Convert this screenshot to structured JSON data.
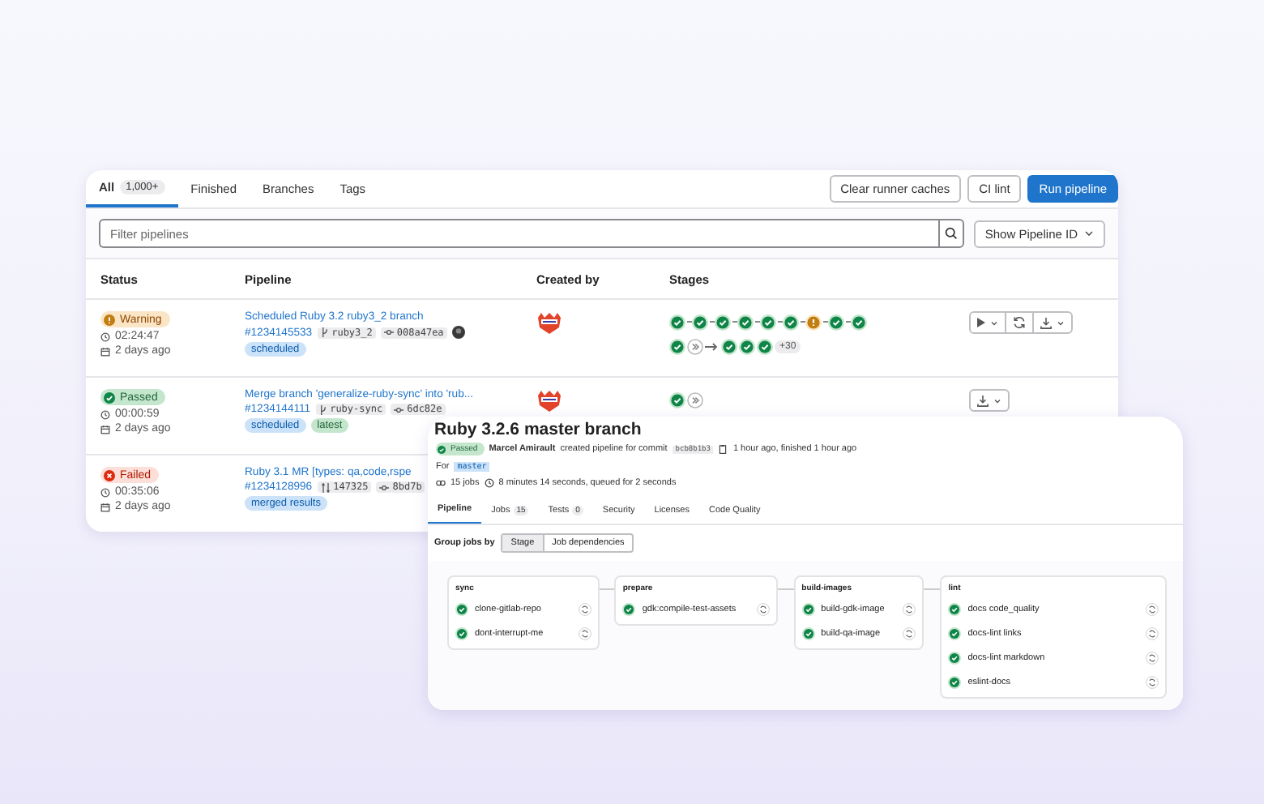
{
  "tabs": [
    {
      "label": "All",
      "count": "1,000+",
      "selected": true
    },
    {
      "label": "Finished",
      "selected": false
    },
    {
      "label": "Branches",
      "selected": false
    },
    {
      "label": "Tags",
      "selected": false
    }
  ],
  "header_buttons": [
    {
      "label": "Clear runner caches",
      "kind": "default"
    },
    {
      "label": "CI lint",
      "kind": "default"
    },
    {
      "label": "Run pipeline",
      "kind": "primary"
    }
  ],
  "filter": {
    "placeholder": "Filter pipelines"
  },
  "show_id_dropdown": "Show Pipeline ID",
  "columns": [
    "Status",
    "Pipeline",
    "Created by",
    "Stages"
  ],
  "rows": [
    {
      "status": {
        "kind": "warning",
        "label": "Warning"
      },
      "duration": "02:24:47",
      "finished": "2 days ago",
      "title": "Scheduled Ruby 3.2 ruby3_2 branch",
      "id": "#1234145533",
      "refs": [
        {
          "kind": "branch",
          "text": "ruby3_2"
        },
        {
          "kind": "commit",
          "text": "008a47ea"
        }
      ],
      "user_avatar": true,
      "tags": [
        {
          "label": "scheduled",
          "kind": "info"
        }
      ],
      "creator_avatar": true,
      "stages": [
        [
          {
            "kind": "success"
          },
          {
            "kind": "success"
          },
          {
            "kind": "success"
          },
          {
            "kind": "success"
          },
          {
            "kind": "success"
          },
          {
            "kind": "success"
          },
          {
            "kind": "warning"
          },
          {
            "kind": "success"
          },
          {
            "kind": "success"
          }
        ],
        [
          {
            "kind": "success"
          },
          {
            "kind": "skipped"
          },
          {
            "kind": "arrow"
          },
          {
            "kind": "success"
          },
          {
            "kind": "success"
          },
          {
            "kind": "success"
          },
          {
            "kind": "more",
            "text": "+30"
          }
        ]
      ],
      "actions": [
        {
          "kind": "play"
        },
        {
          "kind": "retry"
        },
        {
          "kind": "download"
        }
      ]
    },
    {
      "status": {
        "kind": "passed",
        "label": "Passed"
      },
      "duration": "00:00:59",
      "finished": "2 days ago",
      "title": "Merge branch 'generalize-ruby-sync' into 'rub...",
      "id": "#1234144111",
      "refs": [
        {
          "kind": "branch",
          "text": "ruby-sync"
        },
        {
          "kind": "commit",
          "text": "6dc82e"
        }
      ],
      "user_avatar": false,
      "tags": [
        {
          "label": "scheduled",
          "kind": "info"
        },
        {
          "label": "latest",
          "kind": "success"
        }
      ],
      "creator_avatar": true,
      "stages": [
        [
          {
            "kind": "success"
          },
          {
            "kind": "skipped"
          }
        ]
      ],
      "actions": [
        {
          "kind": "download"
        }
      ]
    },
    {
      "status": {
        "kind": "failed",
        "label": "Failed"
      },
      "duration": "00:35:06",
      "finished": "2 days ago",
      "title": "Ruby 3.1 MR [types: qa,code,rspe",
      "id": "#1234128996",
      "refs": [
        {
          "kind": "mr",
          "text": "147325"
        },
        {
          "kind": "commit",
          "text": "8bd7b"
        }
      ],
      "user_avatar": false,
      "tags": [
        {
          "label": "merged results",
          "kind": "info"
        }
      ],
      "creator_avatar": false,
      "stages": [],
      "actions": []
    }
  ],
  "detail": {
    "title": "Ruby 3.2.6 master branch",
    "status": {
      "kind": "passed",
      "label": "Passed"
    },
    "author": "Marcel Amirault",
    "created_text": "created pipeline for commit",
    "commit": "bcb8b1b3",
    "time_text": "1 hour ago, finished 1 hour ago",
    "for_label": "For",
    "branch": "master",
    "jobs_text": "15 jobs",
    "duration_text": "8 minutes 14 seconds, queued for 2 seconds",
    "tabs": [
      {
        "label": "Pipeline",
        "selected": true
      },
      {
        "label": "Jobs",
        "count": "15",
        "selected": false
      },
      {
        "label": "Tests",
        "count": "0",
        "selected": false
      },
      {
        "label": "Security",
        "selected": false
      },
      {
        "label": "Licenses",
        "selected": false
      },
      {
        "label": "Code Quality",
        "selected": false
      }
    ],
    "group_label": "Group jobs by",
    "group_options": [
      {
        "label": "Stage",
        "selected": true
      },
      {
        "label": "Job dependencies",
        "selected": false
      }
    ],
    "stages": [
      {
        "name": "sync",
        "jobs": [
          "clone-gitlab-repo",
          "dont-interrupt-me"
        ]
      },
      {
        "name": "prepare",
        "jobs": [
          "gdk:compile-test-assets"
        ]
      },
      {
        "name": "build-images",
        "jobs": [
          "build-gdk-image",
          "build-qa-image"
        ]
      },
      {
        "name": "lint",
        "jobs": [
          "docs code_quality",
          "docs-lint links",
          "docs-lint markdown",
          "eslint-docs"
        ]
      }
    ]
  }
}
